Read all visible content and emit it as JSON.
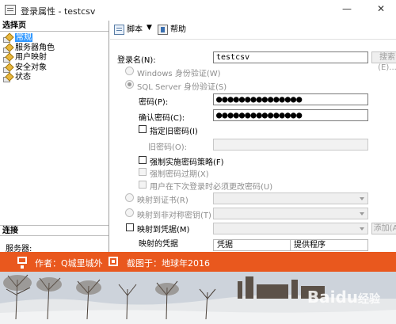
{
  "window": {
    "title": "登录属性 - testcsv",
    "minimize": "—",
    "close": "✕"
  },
  "left_pane": {
    "select_page_header": "选择页",
    "nav_items": [
      {
        "label": "常规",
        "selected": true
      },
      {
        "label": "服务器角色",
        "selected": false
      },
      {
        "label": "用户映射",
        "selected": false
      },
      {
        "label": "安全对象",
        "selected": false
      },
      {
        "label": "状态",
        "selected": false
      }
    ],
    "connection_header": "连接",
    "server_label": "服务器:"
  },
  "toolbar": {
    "script_label": "脚本",
    "help_label": "帮助"
  },
  "form": {
    "login_name_label": "登录名(N):",
    "login_name_value": "testcsv",
    "search_button": "搜索(E)...",
    "windows_auth_label": "Windows 身份验证(W)",
    "sql_auth_label": "SQL Server 身份验证(S)",
    "password_label": "密码(P):",
    "password_value": "●●●●●●●●●●●●●●●",
    "confirm_password_label": "确认密码(C):",
    "confirm_password_value": "●●●●●●●●●●●●●●●",
    "specify_old_password_label": "指定旧密码(I)",
    "old_password_label": "旧密码(O):",
    "enforce_policy_label": "强制实施密码策略(F)",
    "enforce_expiration_label": "强制密码过期(X)",
    "must_change_label": "用户在下次登录时必须更改密码(U)",
    "map_certificate_label": "映射到证书(R)",
    "map_asymmetric_key_label": "映射到非对称密钥(T)",
    "map_credential_label": "映射到凭据(M)",
    "add_button": "添加(A)",
    "mapped_credentials_label": "映射的凭据",
    "grid_columns": [
      "凭据",
      "提供程序"
    ]
  },
  "banner": {
    "author": "作者：Q城里城外",
    "screenshot": "截图于：地球年2016"
  },
  "watermark": {
    "brand": "Baidu",
    "sub": "经验"
  }
}
